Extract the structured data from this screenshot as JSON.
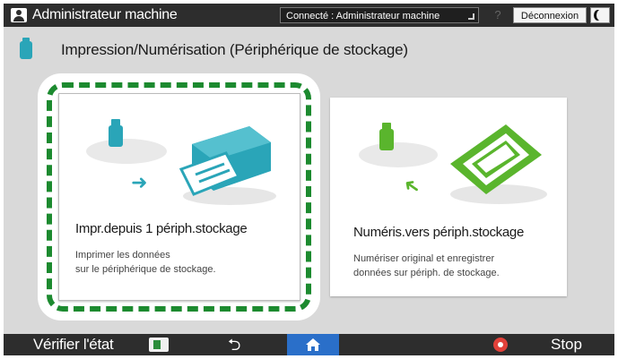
{
  "topbar": {
    "user_name": "Administrateur machine",
    "connected_status": "Connecté : Administrateur machine",
    "help_symbol": "?",
    "logout_label": "Déconnexion",
    "icons": [
      "user-icon",
      "help-icon",
      "night-mode-icon"
    ]
  },
  "header": {
    "title": "Impression/Numérisation (Périphérique de stockage)",
    "icon": "usb-drive-icon"
  },
  "tiles": [
    {
      "title": "Impr.depuis 1 périph.stockage",
      "description_line1": "Imprimer les données",
      "description_line2": "sur le périphérique de stockage.",
      "selected": true,
      "icons": [
        "usb-drive-icon",
        "arrow-right-icon",
        "printer-icon"
      ]
    },
    {
      "title": "Numéris.vers périph.stockage",
      "description_line1": "Numériser original et enregistrer",
      "description_line2": "données sur périph. de stockage.",
      "selected": false,
      "icons": [
        "usb-drive-icon",
        "arrow-left-icon",
        "scanner-icon"
      ]
    }
  ],
  "bottombar": {
    "status_label": "Vérifier l'état",
    "stop_label": "Stop",
    "icons": [
      "job-list-icon",
      "back-icon",
      "home-icon",
      "stop-icon"
    ]
  },
  "colors": {
    "bar_background": "#2d2d2d",
    "screen_background": "#d9d9d9",
    "print_accent": "#2aa5b8",
    "scan_accent": "#5ab52d",
    "selection_dash": "#1c8a2f",
    "home_button": "#2a6fc9",
    "stop_red": "#e2413a"
  }
}
